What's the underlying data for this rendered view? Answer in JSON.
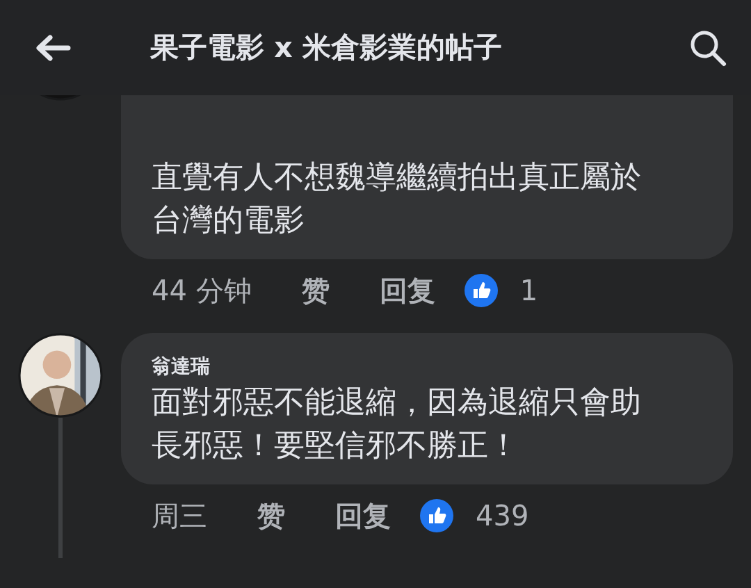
{
  "header": {
    "title": "果子電影 x 米倉影業的帖子"
  },
  "comments": [
    {
      "text": "直覺有人不想魏導繼續拍出真正屬於台灣的電影",
      "time": "44 分钟",
      "like": "赞",
      "reply": "回复",
      "reaction_count": "1",
      "has_replies": false
    },
    {
      "author": "翁達瑞",
      "text": "面對邪惡不能退縮，因為退縮只會助長邪惡！要堅信邪不勝正！",
      "time": "周三",
      "like": "赞",
      "reply": "回复",
      "reaction_count": "439",
      "has_replies": true
    }
  ]
}
